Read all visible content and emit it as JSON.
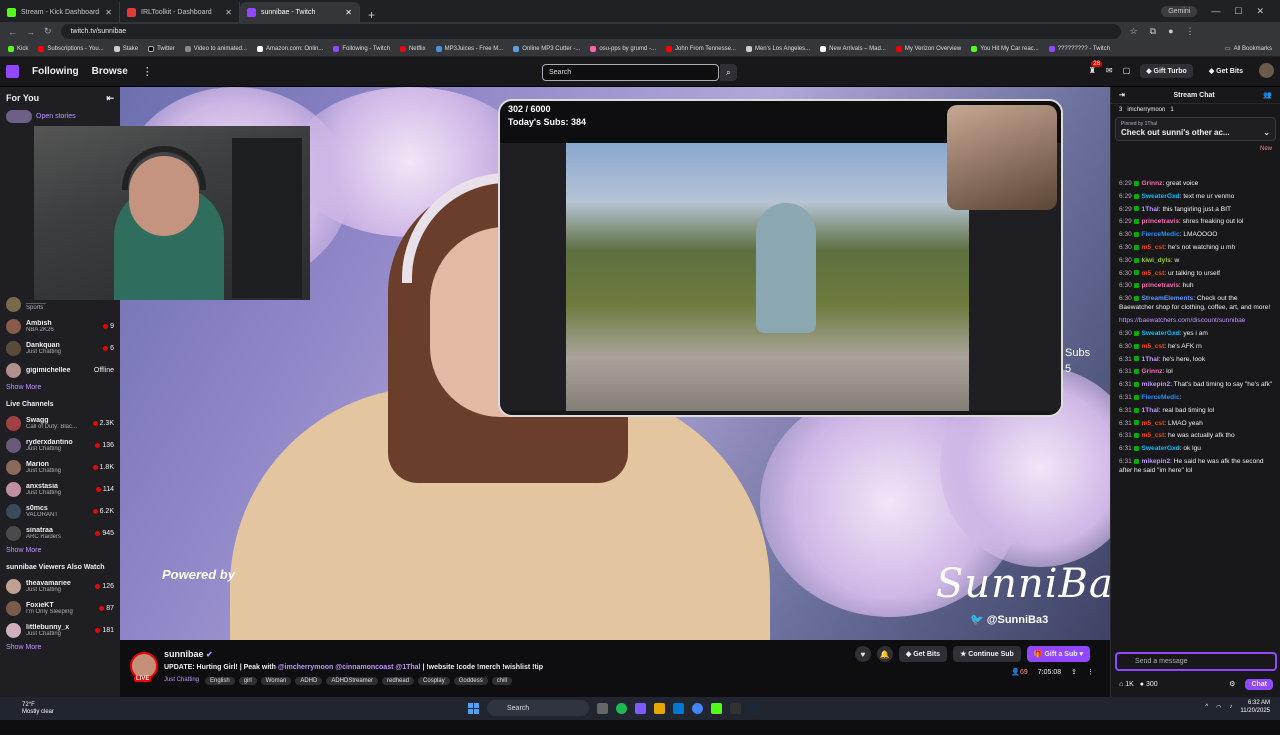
{
  "browser": {
    "tabs": [
      {
        "label": "Stream - Kick Dashboard",
        "color": "#53fc18"
      },
      {
        "label": "IRLToolkit - Dashboard",
        "color": "#e53935"
      },
      {
        "label": "sunnibae - Twitch",
        "color": "#9147ff"
      }
    ],
    "new_tab": "+",
    "gemini": "Gemini",
    "url": "twitch.tv/sunnibae"
  },
  "bookmarks": {
    "items": [
      "Kick",
      "Subscriptions - You...",
      "Stake",
      "Twitter",
      "Video to animated...",
      "Amazon.com: Onlin...",
      "Following - Twitch",
      "Netflix",
      "MP3Juices - Free M...",
      "Online MP3 Cutter -...",
      "osu-pps by grumd -...",
      "John From Tennesse...",
      "Men's Los Angeles...",
      "New Arrivals – Mad...",
      "My Verizon Overview",
      "You Hit My Car reac...",
      "????????? - Twitch"
    ],
    "all": "All Bookmarks"
  },
  "twitch": {
    "nav": {
      "following": "Following",
      "browse": "Browse",
      "search_placeholder": "Search",
      "notif_count": "28",
      "gift_turbo": "Gift Turbo",
      "get_bits": "Get Bits"
    }
  },
  "sidebar": {
    "for_you": "For You",
    "open_stories": "Open stories",
    "followed": [
      {
        "name": "_____",
        "cat": "Sports",
        "viewers": "",
        "color": "#7a6a4a"
      },
      {
        "name": "Ambish",
        "cat": "NBA 2K26",
        "viewers": "9",
        "color": "#8a5a4a"
      },
      {
        "name": "Dankquan",
        "cat": "Just Chatting",
        "viewers": "6",
        "color": "#5a4a3a"
      },
      {
        "name": "gigimichellee",
        "cat": "",
        "viewers": "Offline",
        "color": "#b0908a"
      }
    ],
    "show_more": "Show More",
    "live_channels": "Live Channels",
    "live": [
      {
        "name": "Swagg",
        "cat": "Call of Duty: Blac...",
        "viewers": "2.3K",
        "color": "#a04040"
      },
      {
        "name": "ryderxdantino",
        "cat": "Just Chatting",
        "viewers": "136",
        "color": "#6a5a7a"
      },
      {
        "name": "Marion",
        "cat": "Just Chatting",
        "viewers": "1.8K",
        "color": "#8a6a5a"
      },
      {
        "name": "anxstasia",
        "cat": "Just Chatting",
        "viewers": "114",
        "color": "#c090a0"
      },
      {
        "name": "s0mcs",
        "cat": "VALORANT",
        "viewers": "6.2K",
        "color": "#3a4a5a"
      },
      {
        "name": "sinatraa",
        "cat": "ARC Raiders",
        "viewers": "945",
        "color": "#4a4a4a"
      }
    ],
    "also_watch": "sunnibae Viewers Also Watch",
    "also": [
      {
        "name": "theavamariee",
        "cat": "Just Chatting",
        "viewers": "126",
        "color": "#c0a090"
      },
      {
        "name": "FoxieKT",
        "cat": "I'm Only Sleeping",
        "viewers": "87",
        "color": "#7a5a4a"
      },
      {
        "name": "littlebunny_x",
        "cat": "Just Chatting",
        "viewers": "181",
        "color": "#d0b0c0"
      }
    ]
  },
  "player": {
    "subs_top": "302 / 6000",
    "subs_today": "Today's Subs: 384",
    "subs_right": "Subs",
    "subs_right_num": "5",
    "powered": "Powered by",
    "logo": "SunniBae",
    "handle": "@SunniBa3"
  },
  "info": {
    "name": "sunnibae",
    "live": "LIVE",
    "title_prefix": "UPDATE: Hurting Girl! | Peak with",
    "mention1": "@imcherrymoon",
    "mention2": "@cinnamoncoast",
    "mention3": "@1Thal",
    "title_suffix": "| !website !code !merch !wishlist !tip",
    "category": "Just Chatting",
    "tags": [
      "English",
      "girl",
      "Woman",
      "ADHD",
      "ADHDStreamer",
      "redhead",
      "Cosplay",
      "Goddess",
      "chill"
    ],
    "get_bits": "Get Bits",
    "continue_sub": "Continue Sub",
    "gift_sub": "Gift a Sub",
    "viewers": "69",
    "uptime": "7:05:08"
  },
  "chat": {
    "title": "Stream Chat",
    "gifter_count": "3",
    "gifter_name": "imcherrymoon",
    "gifter_count2": "1",
    "pinned_by": "Pinned by 1Thal",
    "pinned_text": "Check out sunni's other ac...",
    "new_label": "New",
    "messages": [
      {
        "t": "6:29",
        "u": "Grinnz",
        "c": "#ff69b4",
        "m": "great voice"
      },
      {
        "t": "6:29",
        "u": "SweaterGxd",
        "c": "#00bfff",
        "m": "text me ur venmo"
      },
      {
        "t": "6:29",
        "u": "1Thal",
        "c": "#bf94ff",
        "m": "this fangirling just a BIT"
      },
      {
        "t": "6:29",
        "u": "princetravis",
        "c": "#ff69b4",
        "m": "shres freaking out lol"
      },
      {
        "t": "6:30",
        "u": "FierceMedic",
        "c": "#1e90ff",
        "m": "LMAOOOO"
      },
      {
        "t": "6:30",
        "u": "m5_cst",
        "c": "#ff4500",
        "m": "he's not watching u mh"
      },
      {
        "t": "6:30",
        "u": "kiwi_dyls",
        "c": "#9acd32",
        "m": "w"
      },
      {
        "t": "6:30",
        "u": "m5_cst",
        "c": "#ff4500",
        "m": "ur talking to urself"
      },
      {
        "t": "6:30",
        "u": "princetravis",
        "c": "#ff69b4",
        "m": "huh"
      },
      {
        "t": "6:30",
        "u": "StreamElements",
        "c": "#5b99ff",
        "m": "Check out the Baewatcher shop for clothing, coffee, art, and more!"
      },
      {
        "t": "6:30",
        "u": "SweaterGxd",
        "c": "#00bfff",
        "m": "yes i am"
      },
      {
        "t": "6:30",
        "u": "m5_cst",
        "c": "#ff4500",
        "m": "he's AFK rn"
      },
      {
        "t": "6:31",
        "u": "1Thal",
        "c": "#bf94ff",
        "m": "he's here, look"
      },
      {
        "t": "6:31",
        "u": "Grinnz",
        "c": "#ff69b4",
        "m": "lol"
      },
      {
        "t": "6:31",
        "u": "mikepin2",
        "c": "#bf94ff",
        "m": "That's bad timing to say \"he's afk\""
      },
      {
        "t": "6:31",
        "u": "FierceMedic",
        "c": "#1e90ff",
        "m": ""
      },
      {
        "t": "6:31",
        "u": "1Thal",
        "c": "#bf94ff",
        "m": "real bad timing lol"
      },
      {
        "t": "6:31",
        "u": "m5_cst",
        "c": "#ff4500",
        "m": "LMAO yeah"
      },
      {
        "t": "6:31",
        "u": "m5_cst",
        "c": "#ff4500",
        "m": "he was actually afk tho"
      },
      {
        "t": "6:31",
        "u": "SweaterGxd",
        "c": "#00bfff",
        "m": "ok lgu"
      },
      {
        "t": "6:31",
        "u": "mikepin2",
        "c": "#bf94ff",
        "m": "He said he was afk the second after he said \"im here\" lol"
      }
    ],
    "link": "https://baewatchers.com/discount/sunnibae",
    "send_placeholder": "Send a message",
    "points": "1K",
    "bits": "300",
    "chat_btn": "Chat"
  },
  "taskbar": {
    "temp": "72°F",
    "weather": "Mostly clear",
    "search": "Search",
    "time": "6:32 AM",
    "date": "11/20/2025"
  }
}
